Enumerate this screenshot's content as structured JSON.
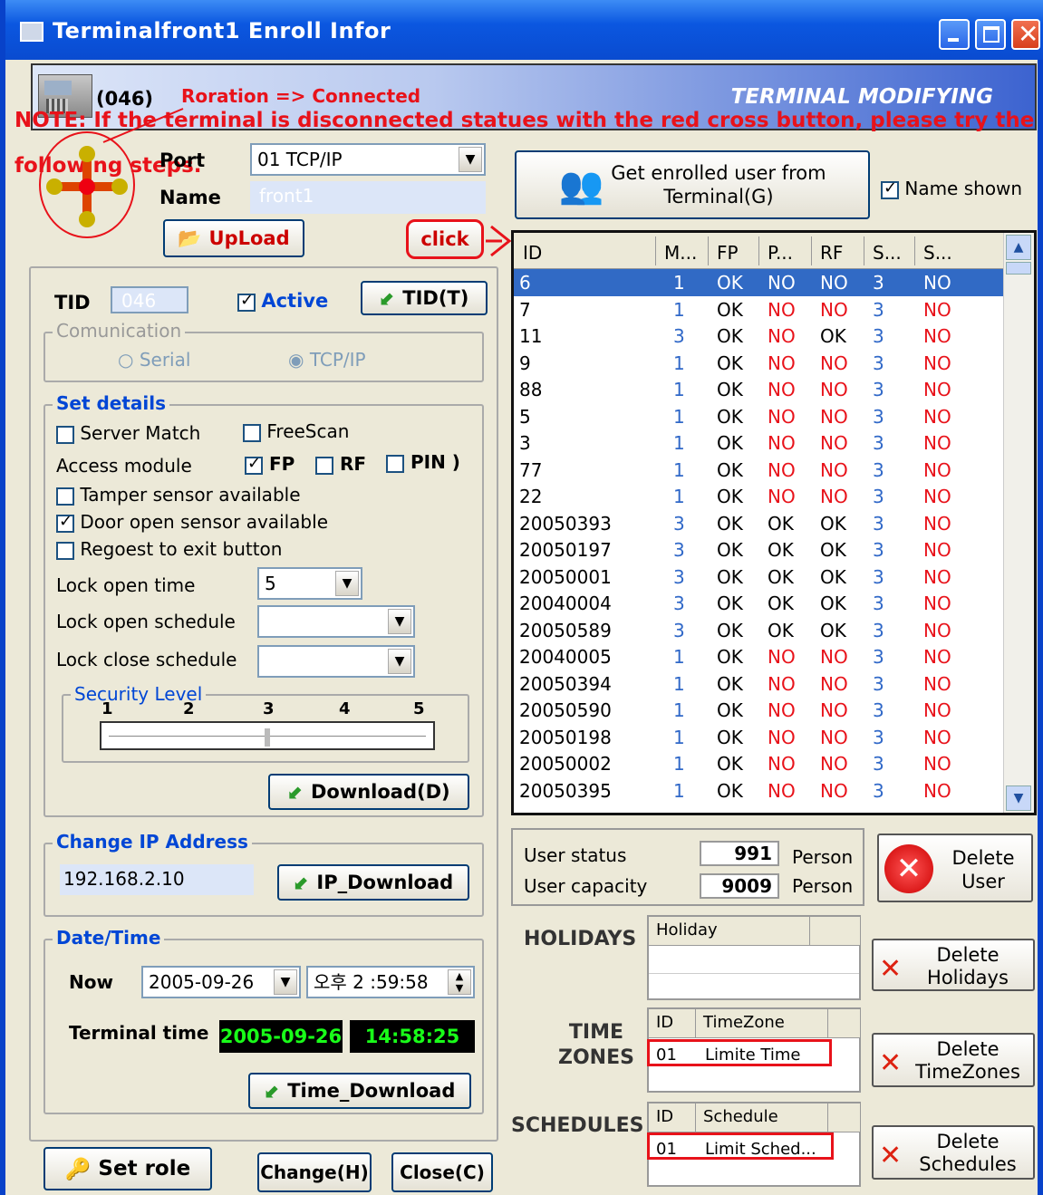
{
  "window": {
    "title": "Terminalfront1 Enroll Infor"
  },
  "banner": {
    "terminal_code": "(046)",
    "status": "Roration => Connected",
    "mode": "TERMINAL MODIFYING",
    "note_line1": "NOTE: If the terminal is disconnected statues with the red cross button, please try the",
    "note_line2": "following steps."
  },
  "port": {
    "label": "Port",
    "value": "01 TCP/IP"
  },
  "name": {
    "label": "Name",
    "value": "front1"
  },
  "upload_label": "UpLoad",
  "click_label": "click",
  "tid": {
    "label": "TID",
    "value": "046",
    "active_label": "Active",
    "button": "TID(T)"
  },
  "comm": {
    "title": "Comunication",
    "serial": "Serial",
    "tcp": "TCP/IP"
  },
  "details": {
    "title": "Set details",
    "server_match": "Server Match",
    "free_scan": "FreeScan",
    "access_module": "Access module",
    "fp": "FP",
    "rf": "RF",
    "pin": "PIN )",
    "tamper": "Tamper sensor available",
    "door_open": "Door open sensor available",
    "request_exit": "Regoest to exit button",
    "lock_open_time": "Lock open time",
    "lock_open_time_value": "5",
    "lock_open_schedule": "Lock open schedule",
    "lock_close_schedule": "Lock close schedule",
    "security_level": "Security Level",
    "levels": [
      "1",
      "2",
      "3",
      "4",
      "5"
    ],
    "security_value": 3,
    "download": "Download(D)"
  },
  "ip": {
    "title": "Change IP Address",
    "value": "192.168.2.10",
    "button": "IP_Download"
  },
  "datetime": {
    "title": "Date/Time",
    "now_label": "Now",
    "date": "2005-09-26",
    "time": "오후 2 :59:58",
    "terminal_label": "Terminal time",
    "terminal_date": "2005-09-26",
    "terminal_time": "14:58:25",
    "button": "Time_Download"
  },
  "bottom": {
    "set_role": "Set role",
    "change": "Change(H)",
    "close": "Close(C)"
  },
  "get_users": {
    "line1": "Get enrolled user from",
    "line2": "Terminal(G)",
    "name_shown": "Name shown"
  },
  "user_list": {
    "columns": [
      "ID",
      "M...",
      "FP",
      "P...",
      "RF",
      "S...",
      "S..."
    ],
    "rows": [
      [
        "6",
        "1",
        "OK",
        "NO",
        "NO",
        "3",
        "NO"
      ],
      [
        "7",
        "1",
        "OK",
        "NO",
        "NO",
        "3",
        "NO"
      ],
      [
        "11",
        "3",
        "OK",
        "NO",
        "OK",
        "3",
        "NO"
      ],
      [
        "9",
        "1",
        "OK",
        "NO",
        "NO",
        "3",
        "NO"
      ],
      [
        "88",
        "1",
        "OK",
        "NO",
        "NO",
        "3",
        "NO"
      ],
      [
        "5",
        "1",
        "OK",
        "NO",
        "NO",
        "3",
        "NO"
      ],
      [
        "3",
        "1",
        "OK",
        "NO",
        "NO",
        "3",
        "NO"
      ],
      [
        "77",
        "1",
        "OK",
        "NO",
        "NO",
        "3",
        "NO"
      ],
      [
        "22",
        "1",
        "OK",
        "NO",
        "NO",
        "3",
        "NO"
      ],
      [
        "20050393",
        "3",
        "OK",
        "OK",
        "OK",
        "3",
        "NO"
      ],
      [
        "20050197",
        "3",
        "OK",
        "OK",
        "OK",
        "3",
        "NO"
      ],
      [
        "20050001",
        "3",
        "OK",
        "OK",
        "OK",
        "3",
        "NO"
      ],
      [
        "20040004",
        "3",
        "OK",
        "OK",
        "OK",
        "3",
        "NO"
      ],
      [
        "20050589",
        "3",
        "OK",
        "OK",
        "OK",
        "3",
        "NO"
      ],
      [
        "20040005",
        "1",
        "OK",
        "NO",
        "NO",
        "3",
        "NO"
      ],
      [
        "20050394",
        "1",
        "OK",
        "NO",
        "NO",
        "3",
        "NO"
      ],
      [
        "20050590",
        "1",
        "OK",
        "NO",
        "NO",
        "3",
        "NO"
      ],
      [
        "20050198",
        "1",
        "OK",
        "NO",
        "NO",
        "3",
        "NO"
      ],
      [
        "20050002",
        "1",
        "OK",
        "NO",
        "NO",
        "3",
        "NO"
      ],
      [
        "20050395",
        "1",
        "OK",
        "NO",
        "NO",
        "3",
        "NO"
      ]
    ]
  },
  "status": {
    "user_status": "User status",
    "user_status_value": "991",
    "user_capacity": "User capacity",
    "user_capacity_value": "9009",
    "unit": "Person"
  },
  "delete_user": {
    "line1": "Delete",
    "line2": "User"
  },
  "holidays": {
    "label": "HOLIDAYS",
    "column": "Holiday",
    "del1": "Delete",
    "del2": "Holidays"
  },
  "timezones": {
    "label1": "TIME",
    "label2": "ZONES",
    "col_id": "ID",
    "col_name": "TimeZone",
    "row_id": "01",
    "row_name": "Limite Time",
    "del1": "Delete",
    "del2": "TimeZones"
  },
  "schedules": {
    "label": "SCHEDULES",
    "col_id": "ID",
    "col_name": "Schedule",
    "row_id": "01",
    "row_name": "Limit Sched...",
    "del1": "Delete",
    "del2": "Schedules"
  }
}
